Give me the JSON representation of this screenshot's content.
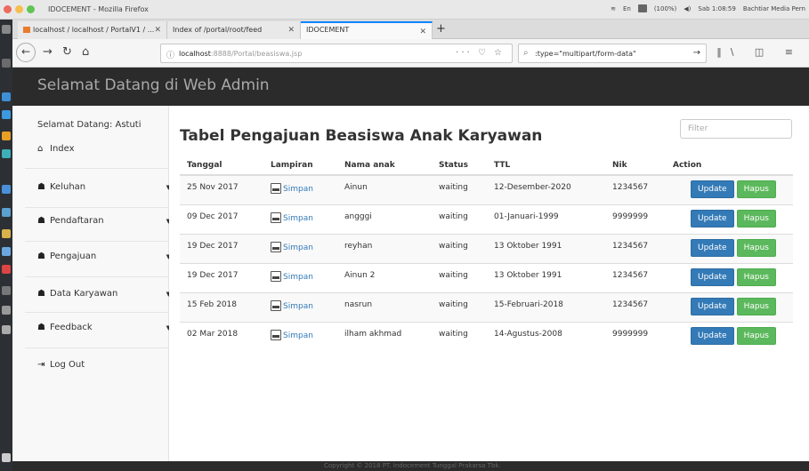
{
  "os": {
    "window_title": "IDOCEMENT - Mozilla Firefox",
    "tray_lang": "En",
    "tray_battery": "(100%)",
    "tray_time": "Sab 1:08:59",
    "tray_user": "Bachtiar Media Pern"
  },
  "browser": {
    "tabs": [
      {
        "label": "localhost / localhost / PortalV1 / ..."
      },
      {
        "label": "Index of /portal/root/feed"
      },
      {
        "label": "IDOCEMENT"
      }
    ],
    "url_host": "localhost",
    "url_path": ":8888/Portal/beasiswa.jsp",
    "search_text": ":type=\"multipart/form-data\""
  },
  "header": {
    "brand": "Selamat Datang di Web Admin"
  },
  "sidebar": {
    "welcome": "Selamat Datang: Astuti",
    "items": [
      {
        "label": "Index",
        "icon": "home-icon"
      },
      {
        "label": "Keluhan",
        "icon": "users-icon"
      },
      {
        "label": "Pendaftaran",
        "icon": "users-icon"
      },
      {
        "label": "Pengajuan",
        "icon": "users-icon"
      },
      {
        "label": "Data Karyawan",
        "icon": "users-icon"
      },
      {
        "label": "Feedback",
        "icon": "users-icon"
      },
      {
        "label": "Log Out",
        "icon": "sign-out-icon"
      }
    ]
  },
  "main": {
    "title": "Tabel Pengajuan Beasiswa Anak Karyawan",
    "filter_placeholder": "Filter",
    "columns": [
      "Tanggal",
      "Lampiran",
      "Nama anak",
      "Status",
      "TTL",
      "Nik",
      "Action"
    ],
    "rows": [
      {
        "tanggal": "25 Nov 2017",
        "lampiran": "Simpan",
        "nama": "Ainun",
        "status": "waiting",
        "ttl": "12-Desember-2020",
        "nik": "1234567",
        "update": "Update",
        "hapus": "Hapus"
      },
      {
        "tanggal": "09 Dec 2017",
        "lampiran": "Simpan",
        "nama": "angggi",
        "status": "waiting",
        "ttl": "01-Januari-1999",
        "nik": "9999999",
        "update": "Update",
        "hapus": "Hapus"
      },
      {
        "tanggal": "19 Dec 2017",
        "lampiran": "Simpan",
        "nama": "reyhan",
        "status": "waiting",
        "ttl": "13 Oktober 1991",
        "nik": "1234567",
        "update": "Update",
        "hapus": "Hapus"
      },
      {
        "tanggal": "19 Dec 2017",
        "lampiran": "Simpan",
        "nama": "Ainun 2",
        "status": "waiting",
        "ttl": "13 Oktober 1991",
        "nik": "1234567",
        "update": "Update",
        "hapus": "Hapus"
      },
      {
        "tanggal": "15 Feb 2018",
        "lampiran": "Simpan",
        "nama": "nasrun",
        "status": "waiting",
        "ttl": "15-Februari-2018",
        "nik": "1234567",
        "update": "Update",
        "hapus": "Hapus"
      },
      {
        "tanggal": "02 Mar 2018",
        "lampiran": "Simpan",
        "nama": "ilham akhmad",
        "status": "waiting",
        "ttl": "14-Agustus-2008",
        "nik": "9999999",
        "update": "Update",
        "hapus": "Hapus"
      }
    ]
  },
  "footer": {
    "text": "Copyright © 2018 PT. Indocement Tunggal Prakarsa Tbk."
  },
  "colors": {
    "header_bg": "#2b2b2b",
    "update_btn": "#337ab7",
    "hapus_btn": "#5cb85c",
    "link": "#337ab7"
  }
}
